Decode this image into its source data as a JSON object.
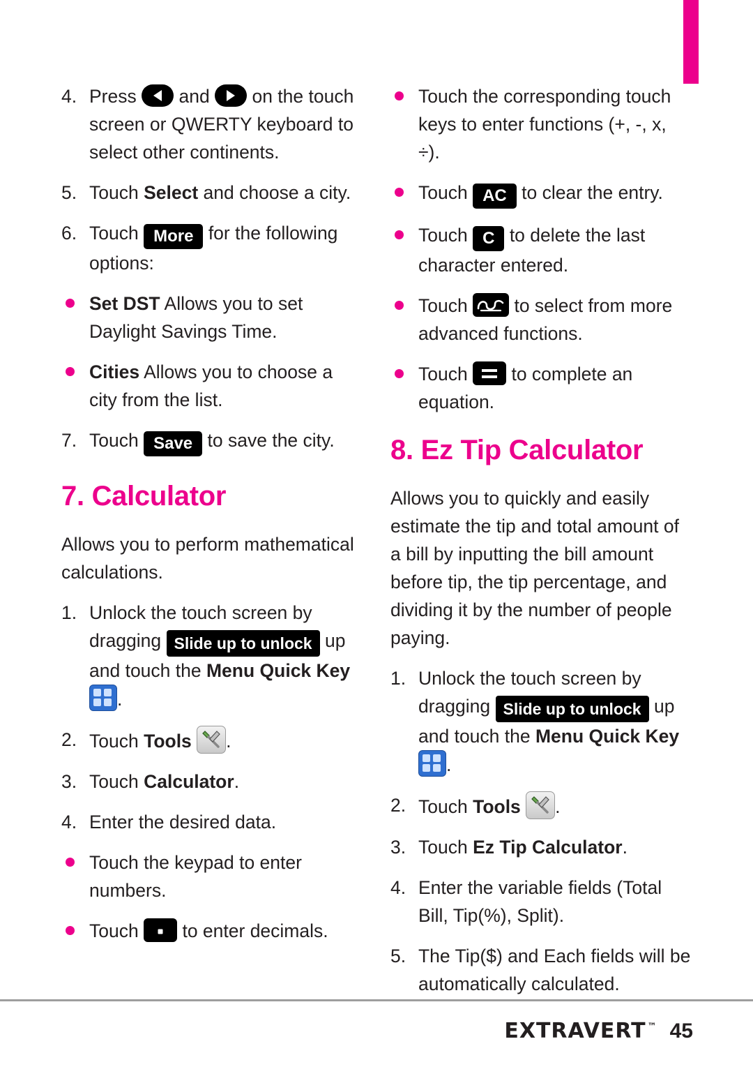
{
  "page": {
    "number": "45",
    "brand": "Extravert",
    "brand_tm": "™"
  },
  "colors": {
    "accent": "#ec008c",
    "text": "#231f20",
    "chip_bg": "#000000",
    "menu_key": "#2f6fd0"
  },
  "left_column": {
    "step4": {
      "num": "4.",
      "text_a": "Press",
      "text_b": "and",
      "text_c": "on the touch screen or QWERTY keyboard to select other continents.",
      "icon_left": "arrow-left-key-icon",
      "icon_right": "arrow-right-key-icon"
    },
    "step5": {
      "num": "5.",
      "text_a": "Touch",
      "bold": "Select",
      "text_b": "and choose a city."
    },
    "step6": {
      "num": "6.",
      "text_a": "Touch",
      "chip": "More",
      "text_b": "for the following options:"
    },
    "bullet_set_dst": {
      "bold": "Set DST",
      "text": "Allows you to set Daylight Savings Time."
    },
    "bullet_cities": {
      "bold": "Cities",
      "text": "Allows you to choose a city from the list."
    },
    "step7": {
      "num": "7.",
      "text_a": "Touch",
      "chip": "Save",
      "text_b": "to save the city."
    },
    "heading": "7. Calculator",
    "intro": "Allows you to perform mathematical calculations.",
    "calc_step1": {
      "num": "1.",
      "text_a": "Unlock the touch screen by dragging",
      "chip": "Slide up to unlock",
      "text_b": "up and touch the",
      "bold": "Menu Quick Key",
      "text_c": ".",
      "icon": "menu-quick-key-icon"
    },
    "calc_step2": {
      "num": "2.",
      "text_a": "Touch",
      "bold": "Tools",
      "text_b": ".",
      "icon": "tools-icon"
    },
    "calc_step3": {
      "num": "3.",
      "text_a": "Touch",
      "bold": "Calculator",
      "text_b": "."
    },
    "calc_step4": {
      "num": "4.",
      "text": "Enter the desired data."
    },
    "bullet_keypad": {
      "text": "Touch the keypad to enter numbers."
    },
    "bullet_decimal": {
      "text_a": "Touch",
      "text_b": "to enter decimals.",
      "icon": "decimal-point-key-icon"
    }
  },
  "right_column": {
    "bullet_functions": {
      "text_a": "Touch the corresponding touch keys to enter functions",
      "text_b": "(+, -, x, ÷)."
    },
    "bullet_ac": {
      "text_a": "Touch",
      "chip": "AC",
      "text_b": "to clear the entry."
    },
    "bullet_c": {
      "text_a": "Touch",
      "chip": "C",
      "text_b": "to delete the last character entered."
    },
    "bullet_advanced": {
      "text_a": "Touch",
      "text_b": "to select from more advanced functions.",
      "icon": "advanced-functions-key-icon"
    },
    "bullet_equals": {
      "text_a": "Touch",
      "text_b": "to complete an equation.",
      "icon": "equals-key-icon"
    },
    "heading": "8. Ez Tip Calculator",
    "intro": "Allows you to quickly and easily estimate the tip and total amount of a bill by inputting the bill amount before tip, the tip percentage, and dividing it by the number of people paying.",
    "tip_step1": {
      "num": "1.",
      "text_a": "Unlock the touch screen by dragging",
      "chip": "Slide up to unlock",
      "text_b": "up and touch the",
      "bold": "Menu Quick Key",
      "text_c": ".",
      "icon": "menu-quick-key-icon"
    },
    "tip_step2": {
      "num": "2.",
      "text_a": "Touch",
      "bold": "Tools",
      "text_b": ".",
      "icon": "tools-icon"
    },
    "tip_step3": {
      "num": "3.",
      "text_a": "Touch",
      "bold": "Ez Tip Calculator",
      "text_b": "."
    },
    "tip_step4": {
      "num": "4.",
      "text": "Enter the variable fields (Total Bill, Tip(%), Split)."
    },
    "tip_step5": {
      "num": "5.",
      "text": "The Tip($) and Each fields will be automatically calculated."
    }
  }
}
